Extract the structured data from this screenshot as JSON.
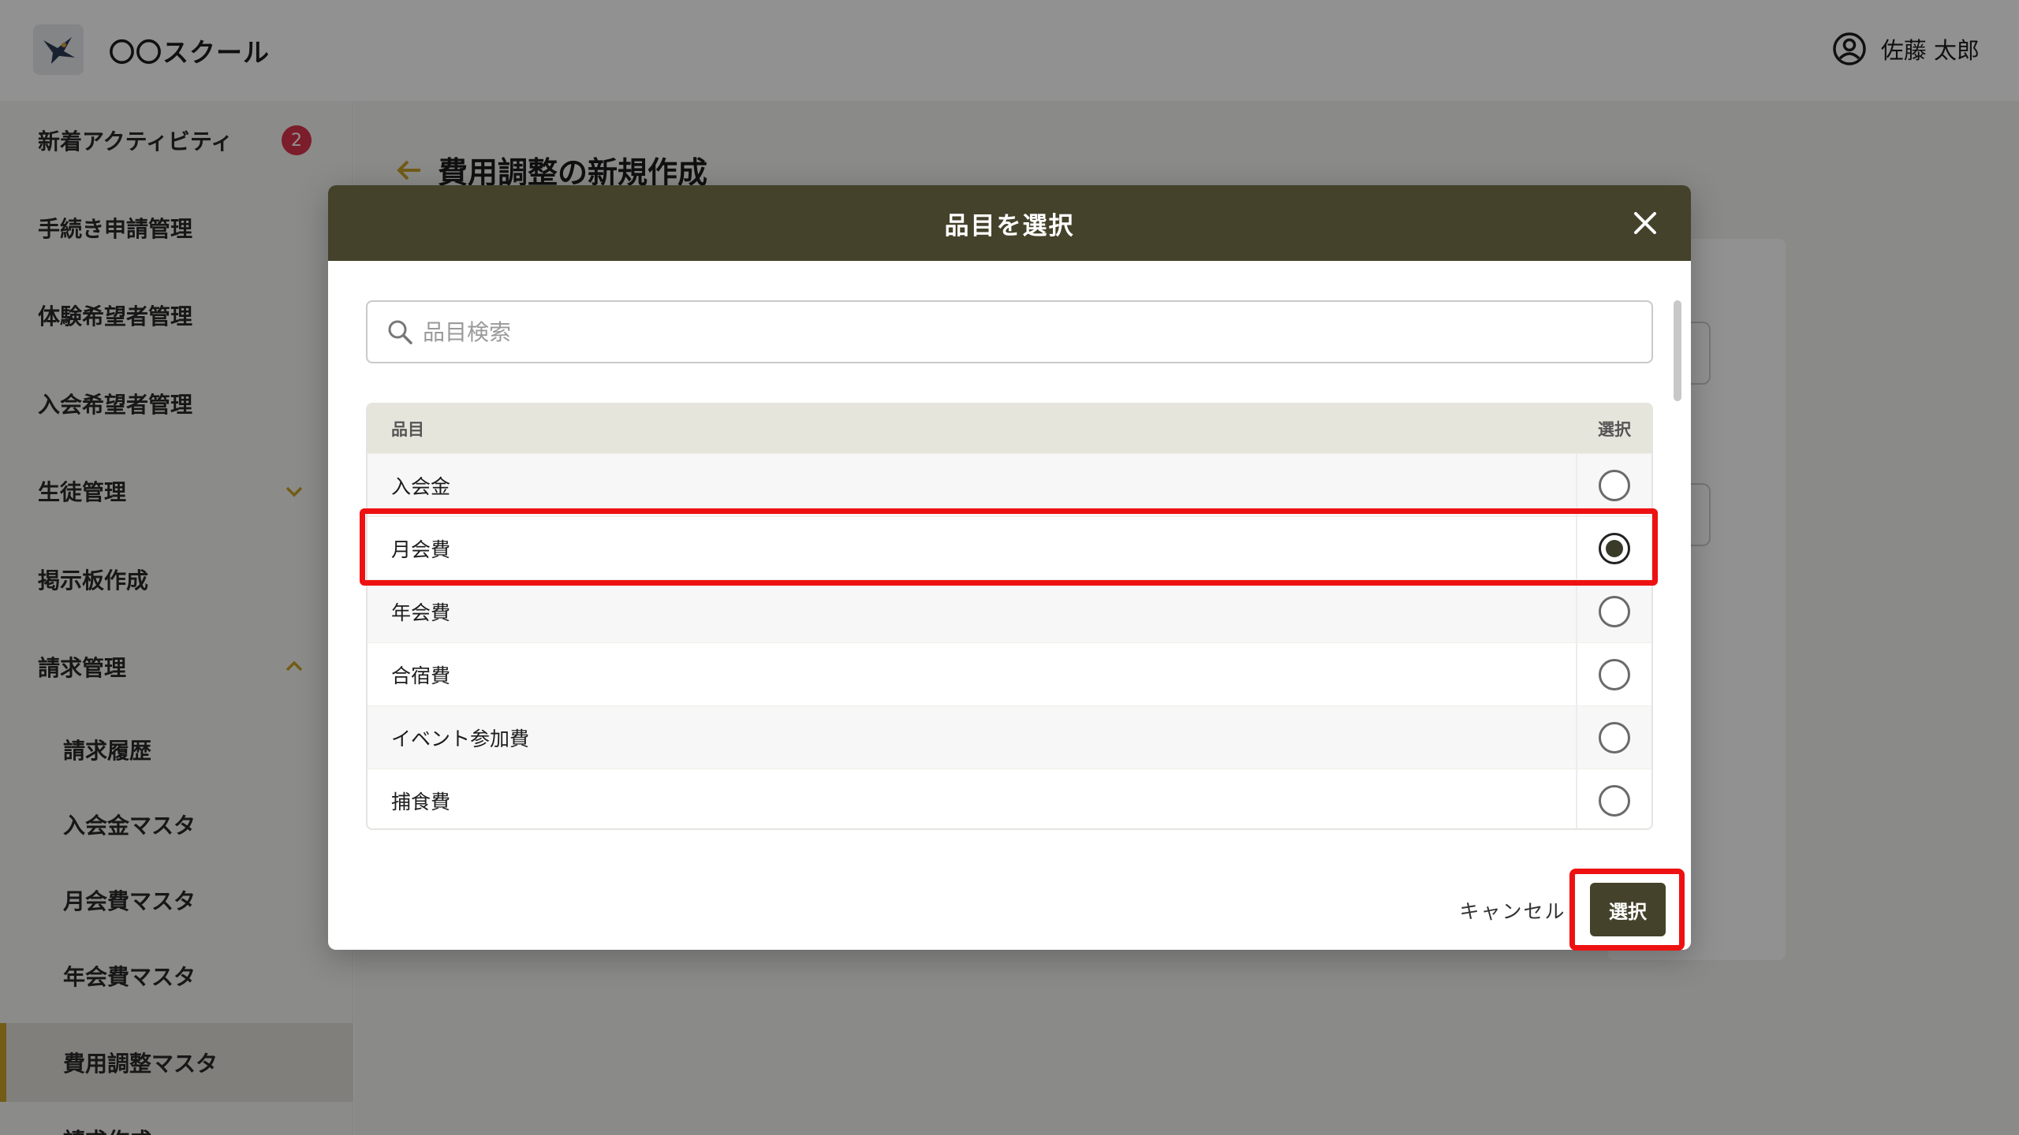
{
  "app": {
    "title": "〇〇スクール",
    "user_name": "佐藤 太郎"
  },
  "sidebar": {
    "items": [
      {
        "label": "新着アクティビティ",
        "badge": "2"
      },
      {
        "label": "手続き申請管理"
      },
      {
        "label": "体験希望者管理"
      },
      {
        "label": "入会希望者管理"
      },
      {
        "label": "生徒管理"
      },
      {
        "label": "掲示板作成"
      },
      {
        "label": "請求管理"
      },
      {
        "label": "請求履歴"
      },
      {
        "label": "入会金マスタ"
      },
      {
        "label": "月会費マスタ"
      },
      {
        "label": "年会費マスタ"
      },
      {
        "label": "費用調整マスタ"
      },
      {
        "label": "請求作成"
      }
    ]
  },
  "page": {
    "heading": "費用調整の新規作成"
  },
  "modal": {
    "title": "品目を選択",
    "search_placeholder": "品目検索",
    "table": {
      "col_item": "品目",
      "col_select": "選択",
      "rows": [
        {
          "name": "入会金",
          "selected": false
        },
        {
          "name": "月会費",
          "selected": true
        },
        {
          "name": "年会費",
          "selected": false
        },
        {
          "name": "合宿費",
          "selected": false
        },
        {
          "name": "イベント参加費",
          "selected": false
        },
        {
          "name": "捕食費",
          "selected": false
        }
      ]
    },
    "cancel_label": "キャンセル",
    "select_label": "選択"
  },
  "colors": {
    "header_bg": "#44422b",
    "accent": "#c9a227",
    "badge": "#d9334a",
    "highlight": "#ee1111"
  }
}
